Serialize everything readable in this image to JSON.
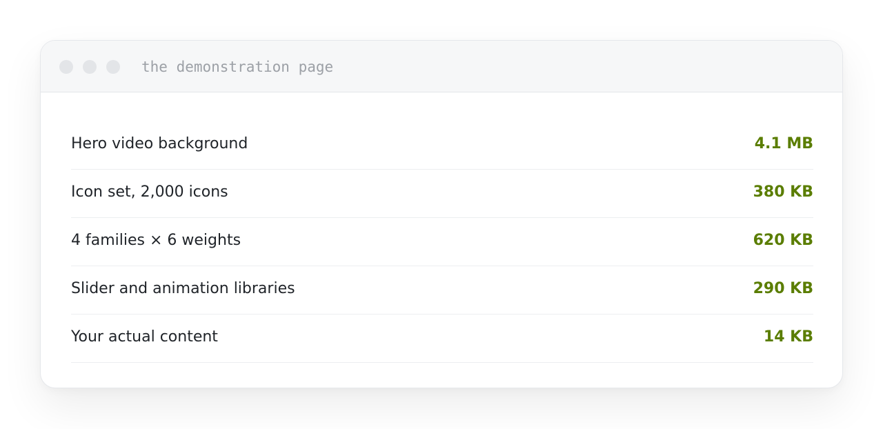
{
  "window": {
    "title": "the demonstration page"
  },
  "rows": [
    {
      "label": "Hero video background",
      "size": "4.1 MB"
    },
    {
      "label": "Icon set, 2,000 icons",
      "size": "380 KB"
    },
    {
      "label": "4 families × 6 weights",
      "size": "620 KB"
    },
    {
      "label": "Slider and animation libraries",
      "size": "290 KB"
    },
    {
      "label": "Your actual content",
      "size": "14 KB"
    }
  ],
  "colors": {
    "size_text": "#5a7d00",
    "label_text": "#1f2328",
    "titlebar_bg": "#f6f7f8",
    "title_text": "#9ca0a6"
  }
}
